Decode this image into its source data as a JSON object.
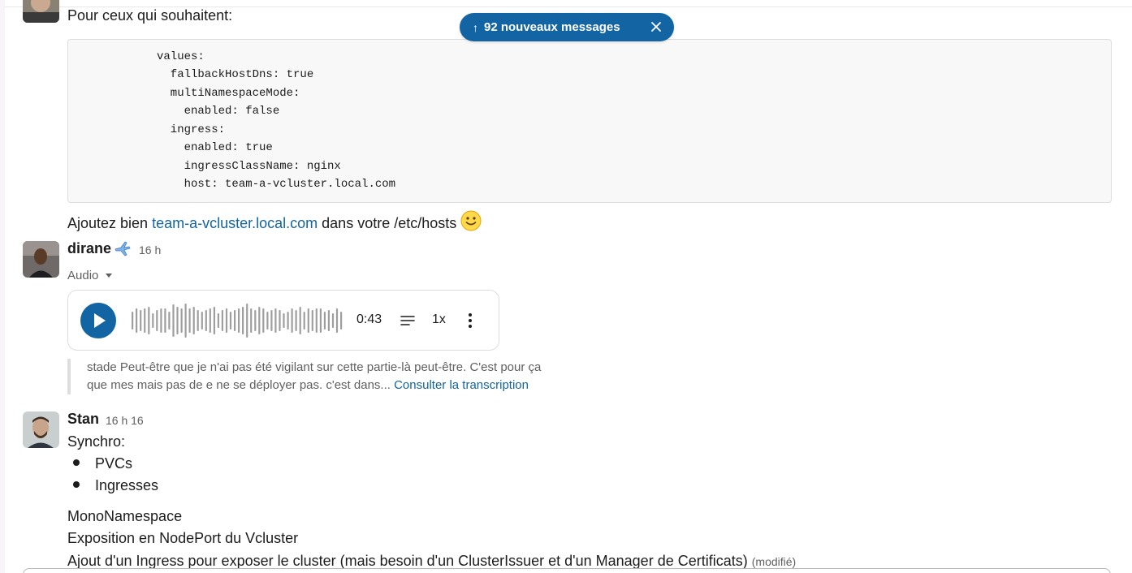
{
  "new_messages_banner": {
    "text": "92 nouveaux messages"
  },
  "first_message": {
    "intro": "Pour ceux qui souhaitent:",
    "code_lines": [
      "values:",
      "  fallbackHostDns: true",
      "  multiNamespaceMode:",
      "    enabled: false",
      "  ingress:",
      "    enabled: true",
      "    ingressClassName: nginx",
      "    host: team-a-vcluster.local.com"
    ],
    "hosts_prefix": "Ajoutez bien ",
    "hosts_link": "team-a-vcluster.local.com",
    "hosts_suffix": " dans votre /etc/hosts "
  },
  "audio_message": {
    "author": "dirane",
    "author_emoji": "airplane-emoji",
    "time": "16 h",
    "label": "Audio",
    "duration": "0:43",
    "speed": "1x",
    "transcript_line1": "stade Peut-être que je n'ai pas été vigilant sur cette partie-là peut-être. C'est pour ça",
    "transcript_line2": "que mes mais pas de e ne se déployer pas. c'est dans... ",
    "transcript_link": "Consulter la transcription"
  },
  "stan_message": {
    "author": "Stan",
    "time": "16 h 16",
    "heading": "Synchro:",
    "bullets": [
      "PVCs",
      "Ingresses"
    ],
    "line1": "MonoNamespace",
    "line2": "Exposition en NodePort du Vcluster",
    "line3": "Ajout d'un Ingress pour exposer le cluster (mais besoin d'un ClusterIssuer et d'un Manager de Certificats)",
    "edited": "(modifié)"
  },
  "colors": {
    "accent": "#1264a3",
    "text": "#1d1c1d",
    "muted": "#616061",
    "code_bg": "#f8f8f8"
  }
}
